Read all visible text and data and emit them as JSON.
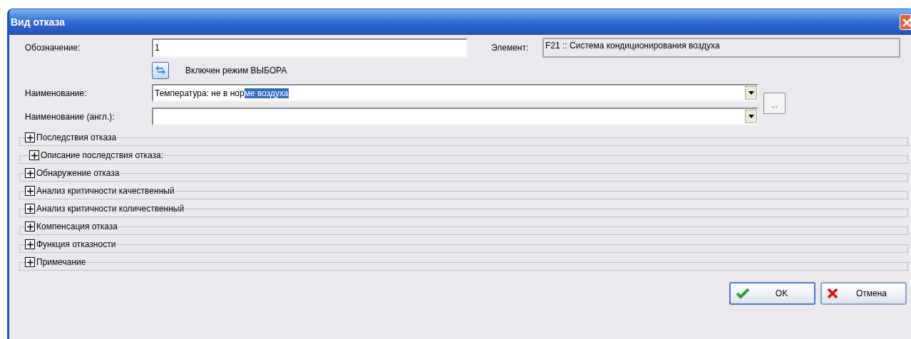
{
  "window": {
    "title": "Вид отказа"
  },
  "designation": {
    "label": "Обозначение:",
    "value": "1"
  },
  "element": {
    "label": "Элемент:",
    "value": "F21 :: Система кондиционирования воздуха"
  },
  "mode": {
    "label": "Включен режим ВЫБОРА"
  },
  "name": {
    "label": "Наименование:",
    "value_parts": [
      {
        "text": "Температура: не в нор",
        "selected": false
      },
      {
        "text": "ме воздуха",
        "selected": true
      }
    ]
  },
  "name_en": {
    "label": "Наименование (англ.):"
  },
  "browse_button": "...",
  "sections": [
    {
      "title": "Последствия отказа",
      "expanded": false
    },
    {
      "title": "Описание последствия отказа:",
      "expanded": false
    },
    {
      "title": "Обнаружение отказа",
      "expanded": false
    },
    {
      "title": "Анализ критичности качественный",
      "expanded": false
    },
    {
      "title": "Анализ критичности количественный",
      "expanded": false
    },
    {
      "title": "Компенсация отказа",
      "expanded": false
    },
    {
      "title": "Функция отказности",
      "expanded": false
    },
    {
      "title": "Примечание",
      "expanded": false
    }
  ],
  "buttons": [
    {
      "label": "OK",
      "kind": "ok"
    },
    {
      "label": "Отмена",
      "kind": "cancel"
    }
  ]
}
